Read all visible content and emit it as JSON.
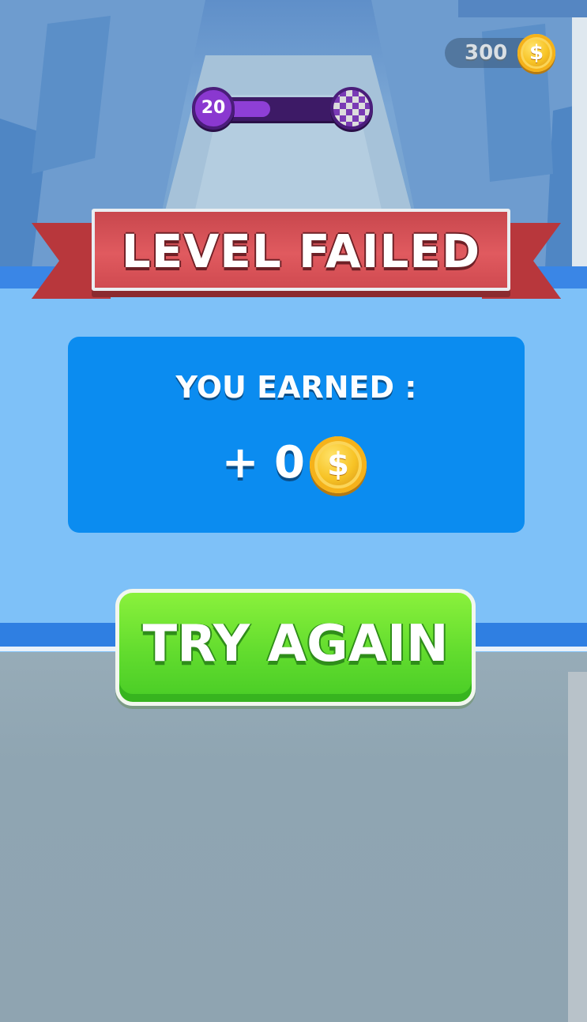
{
  "hud": {
    "coin_balance": "300",
    "current_level": "20",
    "level_progress": 0.4,
    "coin_icon": "dollar-coin-icon",
    "finish_icon": "checkered-flag-icon"
  },
  "banner": {
    "title": "LEVEL FAILED"
  },
  "reward": {
    "label": "YOU EARNED :",
    "amount": "+ 0",
    "coin_symbol": "$"
  },
  "actions": {
    "retry_label": "TRY AGAIN"
  },
  "colors": {
    "banner_red": "#e05a5f",
    "panel_blue": "#0b8cf0",
    "overlay_light_blue": "#7ec1f8",
    "button_green": "#62dc2e",
    "progress_purple": "#8e3fd6"
  }
}
